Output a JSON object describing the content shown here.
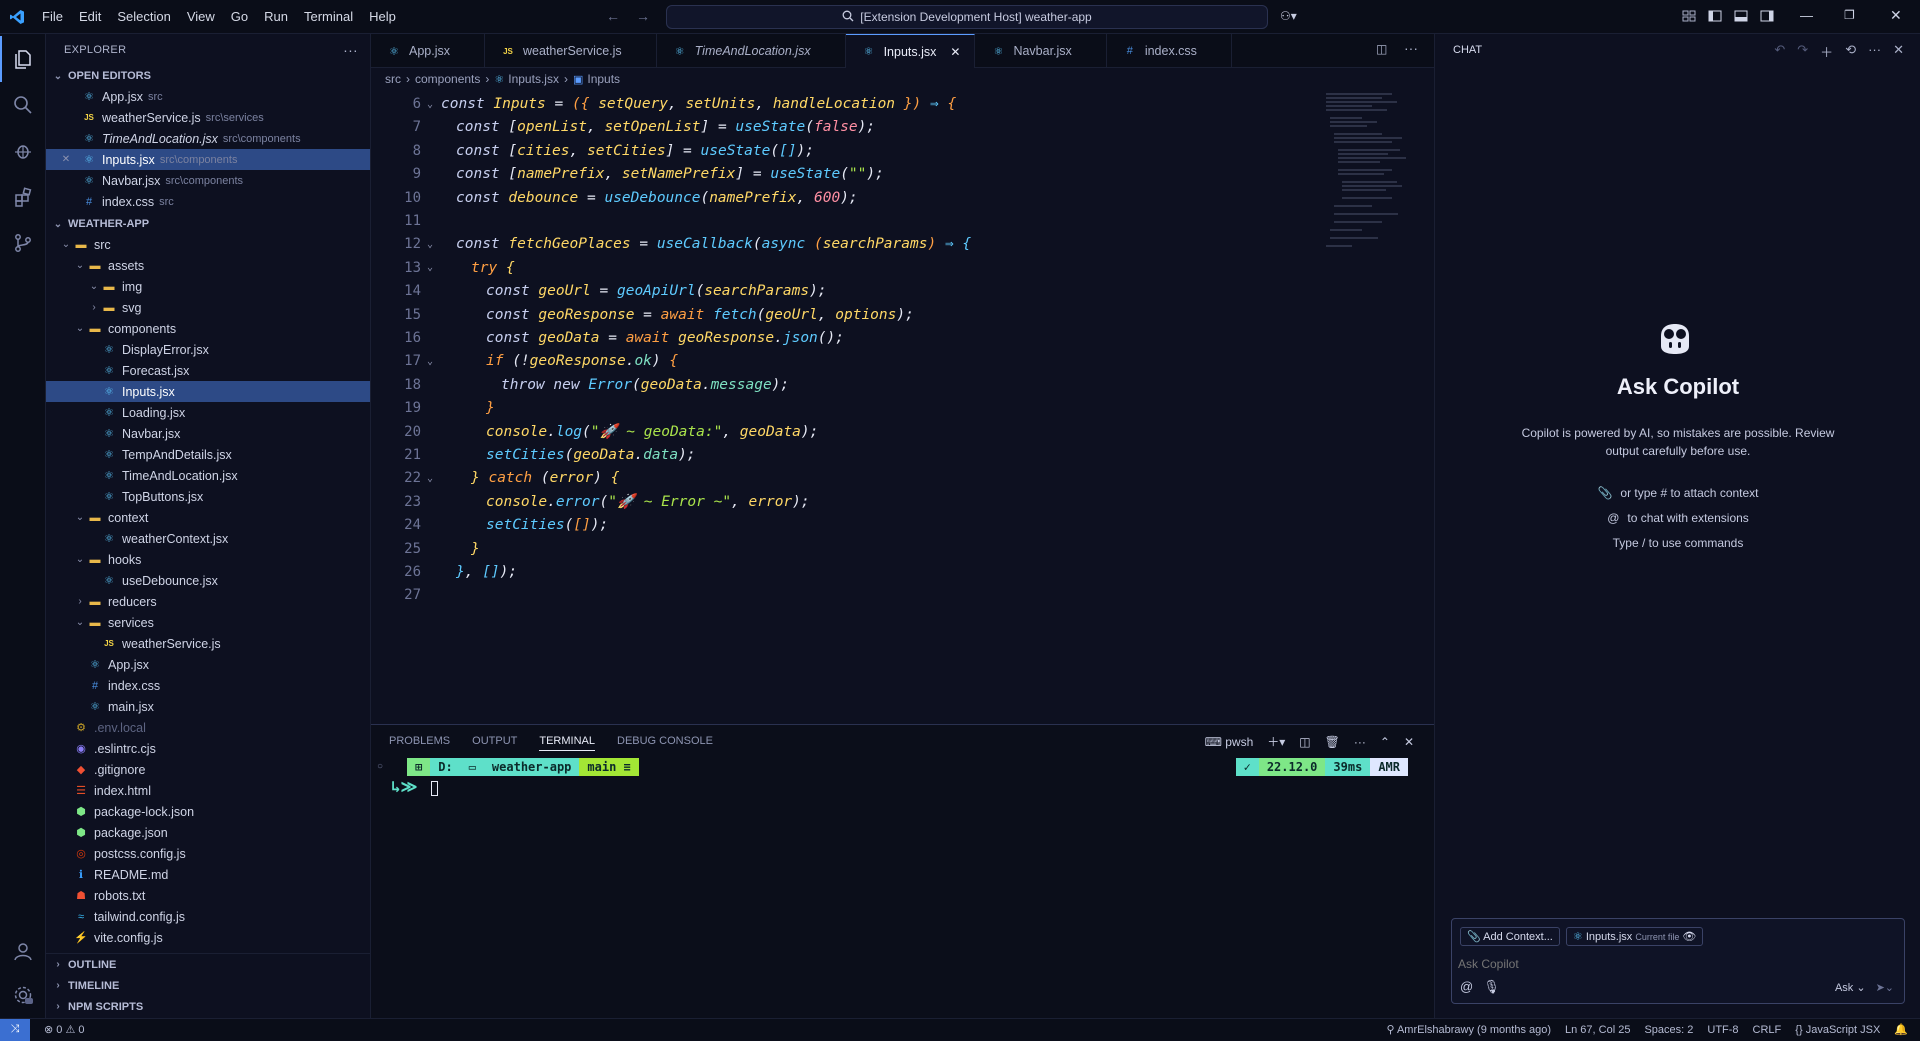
{
  "menu": [
    "File",
    "Edit",
    "Selection",
    "View",
    "Go",
    "Run",
    "Terminal",
    "Help"
  ],
  "command_center": "[Extension Development Host] weather-app",
  "sidebar": {
    "title": "EXPLORER",
    "open_editors_label": "OPEN EDITORS",
    "open_editors": [
      {
        "name": "App.jsx",
        "desc": "src",
        "icon": "react-icon"
      },
      {
        "name": "weatherService.js",
        "desc": "src\\services",
        "icon": "js-icon"
      },
      {
        "name": "TimeAndLocation.jsx",
        "desc": "src\\components",
        "icon": "react-icon",
        "italic": true
      },
      {
        "name": "Inputs.jsx",
        "desc": "src\\components",
        "icon": "react-icon",
        "selected": true
      },
      {
        "name": "Navbar.jsx",
        "desc": "src\\components",
        "icon": "react-icon"
      },
      {
        "name": "index.css",
        "desc": "src",
        "icon": "css-icon"
      }
    ],
    "project_label": "WEATHER-APP",
    "tree": [
      {
        "name": "src",
        "depth": 1,
        "folder": true,
        "open": true
      },
      {
        "name": "assets",
        "depth": 2,
        "folder": true,
        "open": true
      },
      {
        "name": "img",
        "depth": 3,
        "folder": true,
        "open": true
      },
      {
        "name": "svg",
        "depth": 3,
        "folder": true,
        "open": false
      },
      {
        "name": "components",
        "depth": 2,
        "folder": true,
        "open": true
      },
      {
        "name": "DisplayError.jsx",
        "depth": 3
      },
      {
        "name": "Forecast.jsx",
        "depth": 3
      },
      {
        "name": "Inputs.jsx",
        "depth": 3,
        "selected": true
      },
      {
        "name": "Loading.jsx",
        "depth": 3
      },
      {
        "name": "Navbar.jsx",
        "depth": 3
      },
      {
        "name": "TempAndDetails.jsx",
        "depth": 3
      },
      {
        "name": "TimeAndLocation.jsx",
        "depth": 3
      },
      {
        "name": "TopButtons.jsx",
        "depth": 3
      },
      {
        "name": "context",
        "depth": 2,
        "folder": true,
        "open": true
      },
      {
        "name": "weatherContext.jsx",
        "depth": 3
      },
      {
        "name": "hooks",
        "depth": 2,
        "folder": true,
        "open": true
      },
      {
        "name": "useDebounce.jsx",
        "depth": 3
      },
      {
        "name": "reducers",
        "depth": 2,
        "folder": true,
        "open": false
      },
      {
        "name": "services",
        "depth": 2,
        "folder": true,
        "open": true
      },
      {
        "name": "weatherService.js",
        "depth": 3,
        "icon": "js"
      },
      {
        "name": "App.jsx",
        "depth": 2
      },
      {
        "name": "index.css",
        "depth": 2,
        "icon": "css"
      },
      {
        "name": "main.jsx",
        "depth": 2
      },
      {
        "name": ".env.local",
        "depth": 1,
        "icon": "env",
        "dim": true
      },
      {
        "name": ".eslintrc.cjs",
        "depth": 1,
        "icon": "eslint"
      },
      {
        "name": ".gitignore",
        "depth": 1,
        "icon": "git"
      },
      {
        "name": "index.html",
        "depth": 1,
        "icon": "html"
      },
      {
        "name": "package-lock.json",
        "depth": 1,
        "icon": "npm"
      },
      {
        "name": "package.json",
        "depth": 1,
        "icon": "npm"
      },
      {
        "name": "postcss.config.js",
        "depth": 1,
        "icon": "postcss"
      },
      {
        "name": "README.md",
        "depth": 1,
        "icon": "info"
      },
      {
        "name": "robots.txt",
        "depth": 1,
        "icon": "robot"
      },
      {
        "name": "tailwind.config.js",
        "depth": 1,
        "icon": "tailwind"
      },
      {
        "name": "vite.config.js",
        "depth": 1,
        "icon": "vite"
      }
    ],
    "bottom_sections": [
      "OUTLINE",
      "TIMELINE",
      "NPM SCRIPTS"
    ]
  },
  "tabs": [
    {
      "label": "App.jsx",
      "icon": "react"
    },
    {
      "label": "weatherService.js",
      "icon": "js"
    },
    {
      "label": "TimeAndLocation.jsx",
      "icon": "react",
      "italic": true
    },
    {
      "label": "Inputs.jsx",
      "icon": "react",
      "active": true
    },
    {
      "label": "Navbar.jsx",
      "icon": "react"
    },
    {
      "label": "index.css",
      "icon": "css"
    }
  ],
  "breadcrumb": [
    "src",
    "components",
    "Inputs.jsx",
    "Inputs"
  ],
  "code": [
    {
      "n": "6",
      "fold": true,
      "html": "<span class='kw'>const</span> <span class='var'>Inputs</span> <span class='punc'>=</span> <span class='ctl'>({</span> <span class='var'>setQuery</span><span class='punc'>,</span> <span class='var'>setUnits</span><span class='punc'>,</span> <span class='var'>handleLocation</span> <span class='ctl'>})</span> <span class='fn'>⇒</span> <span class='ctl'>{</span>"
    },
    {
      "n": "7",
      "indent": 1,
      "html": "<span class='kw'>const</span> <span class='punc'>[</span><span class='var'>openList</span><span class='punc'>,</span> <span class='var'>setOpenList</span><span class='punc'>]</span> <span class='punc'>=</span> <span class='fn'>useState</span><span class='punc'>(</span><span class='num'>false</span><span class='punc'>);</span>"
    },
    {
      "n": "8",
      "indent": 1,
      "html": "<span class='kw'>const</span> <span class='punc'>[</span><span class='var'>cities</span><span class='punc'>,</span> <span class='var'>setCities</span><span class='punc'>]</span> <span class='punc'>=</span> <span class='fn'>useState</span><span class='punc'>(</span><span class='fn'>[]</span><span class='punc'>);</span>"
    },
    {
      "n": "9",
      "indent": 1,
      "html": "<span class='kw'>const</span> <span class='punc'>[</span><span class='var'>namePrefix</span><span class='punc'>,</span> <span class='var'>setNamePrefix</span><span class='punc'>]</span> <span class='punc'>=</span> <span class='fn'>useState</span><span class='punc'>(</span><span class='str'>\"\"</span><span class='punc'>);</span>"
    },
    {
      "n": "10",
      "indent": 1,
      "html": "<span class='kw'>const</span> <span class='var'>debounce</span> <span class='punc'>=</span> <span class='fn'>useDebounce</span><span class='punc'>(</span><span class='var'>namePrefix</span><span class='punc'>,</span> <span class='num'>600</span><span class='punc'>);</span>"
    },
    {
      "n": "11",
      "html": ""
    },
    {
      "n": "12",
      "fold": true,
      "indent": 1,
      "html": "<span class='kw'>const</span> <span class='var'>fetchGeoPlaces</span> <span class='punc'>=</span> <span class='fn'>useCallback</span><span class='punc'>(</span><span class='fn'>async</span> <span class='ctl'>(</span><span class='var'>searchParams</span><span class='ctl'>)</span> <span class='fn'>⇒</span> <span class='fn'>{</span>"
    },
    {
      "n": "13",
      "fold": true,
      "indent": 2,
      "html": "<span class='ctl'>try</span> <span class='var'>{</span>"
    },
    {
      "n": "14",
      "indent": 3,
      "html": "<span class='kw'>const</span> <span class='var'>geoUrl</span> <span class='punc'>=</span> <span class='fn'>geoApiUrl</span><span class='punc'>(</span><span class='var'>searchParams</span><span class='punc'>);</span>"
    },
    {
      "n": "15",
      "indent": 3,
      "html": "<span class='kw'>const</span> <span class='var'>geoResponse</span> <span class='punc'>=</span> <span class='ctl'>await</span> <span class='fn'>fetch</span><span class='punc'>(</span><span class='var'>geoUrl</span><span class='punc'>,</span> <span class='var'>options</span><span class='punc'>);</span>"
    },
    {
      "n": "16",
      "indent": 3,
      "html": "<span class='kw'>const</span> <span class='var'>geoData</span> <span class='punc'>=</span> <span class='ctl'>await</span> <span class='var'>geoResponse</span><span class='punc'>.</span><span class='fn'>json</span><span class='punc'>();</span>"
    },
    {
      "n": "17",
      "fold": true,
      "indent": 3,
      "html": "<span class='ctl'>if</span> <span class='punc'>(!</span><span class='var'>geoResponse</span><span class='punc'>.</span><span class='prop'>ok</span><span class='punc'>)</span> <span class='ctl'>{</span>"
    },
    {
      "n": "18",
      "indent": 4,
      "html": "<span class='kw'>throw</span> <span class='kw'>new</span> <span class='fn'>Error</span><span class='punc'>(</span><span class='var'>geoData</span><span class='punc'>.</span><span class='prop'>message</span><span class='punc'>);</span>"
    },
    {
      "n": "19",
      "indent": 3,
      "html": "<span class='ctl'>}</span>"
    },
    {
      "n": "20",
      "indent": 3,
      "html": "<span class='var'>console</span><span class='punc'>.</span><span class='fn'>log</span><span class='punc'>(</span><span class='str'>\"🚀 ~ geoData:\"</span><span class='punc'>,</span> <span class='var'>geoData</span><span class='punc'>);</span>"
    },
    {
      "n": "21",
      "indent": 3,
      "html": "<span class='fn'>setCities</span><span class='punc'>(</span><span class='var'>geoData</span><span class='punc'>.</span><span class='prop'>data</span><span class='punc'>);</span>"
    },
    {
      "n": "22",
      "fold": true,
      "indent": 2,
      "html": "<span class='var'>}</span> <span class='ctl'>catch</span> <span class='punc'>(</span><span class='var'>error</span><span class='punc'>)</span> <span class='var'>{</span>"
    },
    {
      "n": "23",
      "indent": 3,
      "html": "<span class='var'>console</span><span class='punc'>.</span><span class='fn'>error</span><span class='punc'>(</span><span class='str'>\"🚀 ~ Error ~\"</span><span class='punc'>,</span> <span class='var'>error</span><span class='punc'>);</span>"
    },
    {
      "n": "24",
      "indent": 3,
      "html": "<span class='fn'>setCities</span><span class='punc'>(</span><span class='ctl'>[]</span><span class='punc'>);</span>"
    },
    {
      "n": "25",
      "indent": 2,
      "html": "<span class='var'>}</span>"
    },
    {
      "n": "26",
      "indent": 1,
      "html": "<span class='fn'>}</span><span class='punc'>,</span> <span class='fn'>[]</span><span class='punc'>);</span>"
    },
    {
      "n": "27",
      "html": ""
    }
  ],
  "panel": {
    "tabs": [
      "PROBLEMS",
      "OUTPUT",
      "TERMINAL",
      "DEBUG CONSOLE"
    ],
    "active_tab": "TERMINAL",
    "shell": "pwsh",
    "prompt_left": [
      "D:",
      "weather-app",
      "main ≡"
    ],
    "prompt_right": [
      "22.12.0",
      "39ms",
      "AMR"
    ]
  },
  "chat": {
    "title": "CHAT",
    "heading": "Ask Copilot",
    "disclaimer": "Copilot is powered by AI, so mistakes are possible. Review output carefully before use.",
    "hints": [
      {
        "icon": "paperclip-icon",
        "text": "or type # to attach context"
      },
      {
        "icon": "at-icon",
        "text": "to chat with extensions"
      },
      {
        "icon": "",
        "text": "Type / to use commands"
      }
    ],
    "add_context": "Add Context...",
    "current_file": "Inputs.jsx",
    "current_file_desc": "Current file",
    "input_placeholder": "Ask Copilot",
    "mode": "Ask"
  },
  "status": {
    "problems": "0",
    "warnings": "0",
    "blame": "AmrElshabrawy (9 months ago)",
    "position": "Ln 67, Col 25",
    "spaces": "Spaces: 2",
    "encoding": "UTF-8",
    "eol": "CRLF",
    "language": "JavaScript JSX"
  },
  "colors": {
    "accent": "#5b9cff",
    "selection": "#2d4a86",
    "background": "#0d1020"
  }
}
